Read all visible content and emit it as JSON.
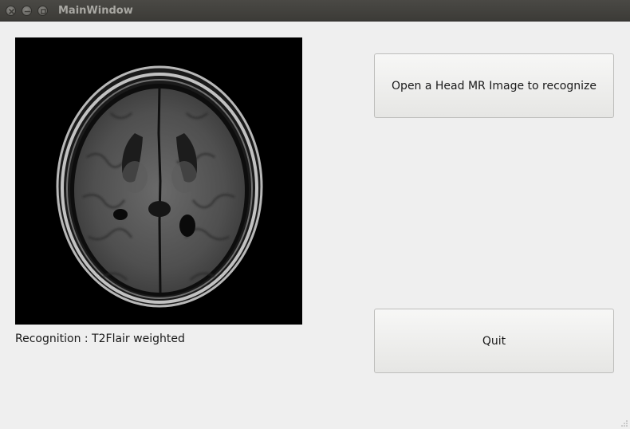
{
  "window": {
    "title": "MainWindow"
  },
  "titlebar_buttons": [
    "close-icon",
    "minimize-icon",
    "maximize-icon"
  ],
  "image_view": {
    "content": "axial head MR image",
    "background": "#000000"
  },
  "recognition": {
    "text": "Recognition : T2Flair weighted"
  },
  "buttons": {
    "open_label": "Open a Head MR Image to recognize",
    "quit_label": "Quit"
  },
  "colors": {
    "window_bg": "#efefef",
    "titlebar_bg": "#3c3b37",
    "title_text": "#a9a8a3"
  }
}
